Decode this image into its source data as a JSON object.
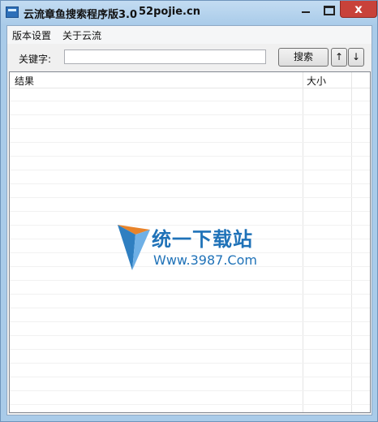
{
  "window": {
    "title": "云流章鱼搜索程序版3.0",
    "site": "52pojie.cn",
    "close_glyph": "x"
  },
  "menu": {
    "items": [
      "版本设置",
      "关于云流"
    ]
  },
  "search": {
    "label": "关键字:",
    "value": "",
    "button": "搜索",
    "up": "↑",
    "down": "↓"
  },
  "list": {
    "columns": [
      "结果",
      "大小"
    ],
    "rows": []
  },
  "watermark": {
    "title": "统一下载站",
    "url": "Www.3987.Com"
  },
  "colors": {
    "frame": "#a9cbe9",
    "close": "#c8423a",
    "watermark": "#1f72b8"
  }
}
